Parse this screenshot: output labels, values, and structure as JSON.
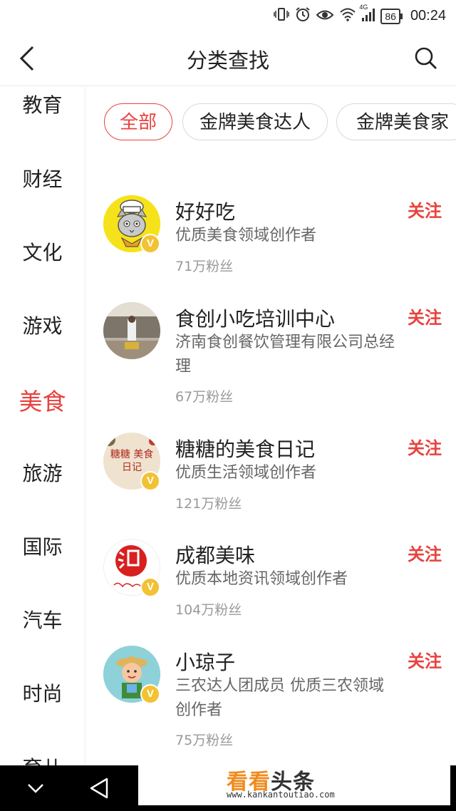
{
  "status_bar": {
    "battery": "86",
    "time": "00:24",
    "network": "4G"
  },
  "header": {
    "title": "分类查找"
  },
  "sidebar": {
    "items": [
      "教育",
      "财经",
      "文化",
      "游戏",
      "美食",
      "旅游",
      "国际",
      "汽车",
      "时尚",
      "育儿"
    ],
    "active": "美食"
  },
  "chips": [
    "全部",
    "金牌美食达人",
    "金牌美食家"
  ],
  "list": [
    {
      "name": "好好吃",
      "desc": "优质美食领域创作者",
      "fans": "71万粉丝",
      "follow": "关注"
    },
    {
      "name": "食创小吃培训中心",
      "desc": "济南食创餐饮管理有限公司总经理",
      "fans": "67万粉丝",
      "follow": "关注"
    },
    {
      "name": "糖糖的美食日记",
      "desc": "优质生活领域创作者",
      "fans": "121万粉丝",
      "follow": "关注",
      "avatar_text": "糖糖 美食日记"
    },
    {
      "name": "成都美味",
      "desc": "优质本地资讯领域创作者",
      "fans": "104万粉丝",
      "follow": "关注"
    },
    {
      "name": "小琼子",
      "desc": "三农达人团成员 优质三农领域创作者",
      "fans": "75万粉丝",
      "follow": "关注"
    }
  ],
  "verified_mark": "V",
  "watermark": {
    "logo_a": "看看",
    "logo_b": "头条",
    "url": "www.kankantoutiao.com"
  },
  "colors": {
    "accent": "#e8423e",
    "badge": "#f2c233"
  }
}
